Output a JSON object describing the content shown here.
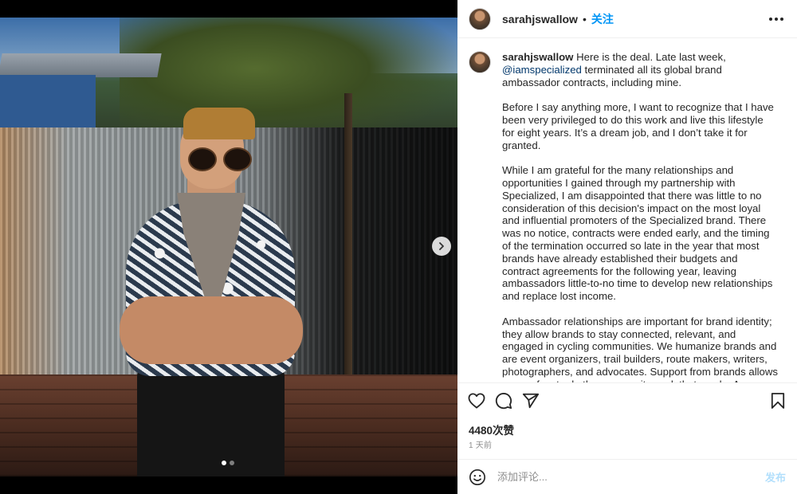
{
  "post": {
    "image_alt": "Photo of a person in sunglasses and a cap standing in front of a corrugated metal fence",
    "carousel": {
      "total": 2,
      "current": 1
    }
  },
  "header": {
    "username": "sarahjswallow",
    "separator": "•",
    "follow_label": "关注"
  },
  "caption": {
    "username": "sarahjswallow",
    "first_part": "Here is the deal. Late last week, ",
    "mention": "@iamspecialized",
    "after_mention": " terminated all its global brand ambassador contracts, including mine.",
    "paragraph_2": "Before I say anything more, I want to recognize that I have been very privileged to do this work and live this lifestyle for eight years. It’s a dream job, and I don’t take it for granted.",
    "paragraph_3": "While I am grateful for the many relationships and opportunities I gained through my partnership with Specialized, I am disappointed that there was little to no consideration of this decision's impact on the most loyal and influential promoters of the Specialized brand. There was no notice, contracts were ended early, and the timing of the termination occurred so late in the year that most brands have already established their budgets and contract agreements for the following year, leaving ambassadors little-to-no time to develop new relationships and replace lost income.",
    "paragraph_4": "Ambassador relationships are important for brand identity; they allow brands to stay connected, relevant, and engaged in cycling communities. We humanize brands and are event organizers, trail builders, route makers, writers, photographers, and advocates. Support from brands allows many of us to do the community work that we do. As a relatively new field in the industry, we can learn from this"
  },
  "stats": {
    "likes": "4480次赞",
    "posted": "1 天前"
  },
  "comment": {
    "placeholder": "添加评论...",
    "post_label": "发布"
  },
  "icons": {
    "more": "more-horizontal-icon",
    "like": "heart-icon",
    "comment": "comment-icon",
    "share": "send-icon",
    "save": "bookmark-icon",
    "emoji": "emoji-icon",
    "next": "chevron-right-icon"
  },
  "colors": {
    "link_blue": "#0095f6",
    "mention_blue": "#00376b",
    "text": "#262626",
    "muted": "#8e8e8e",
    "post_disabled": "#b2dffc"
  }
}
